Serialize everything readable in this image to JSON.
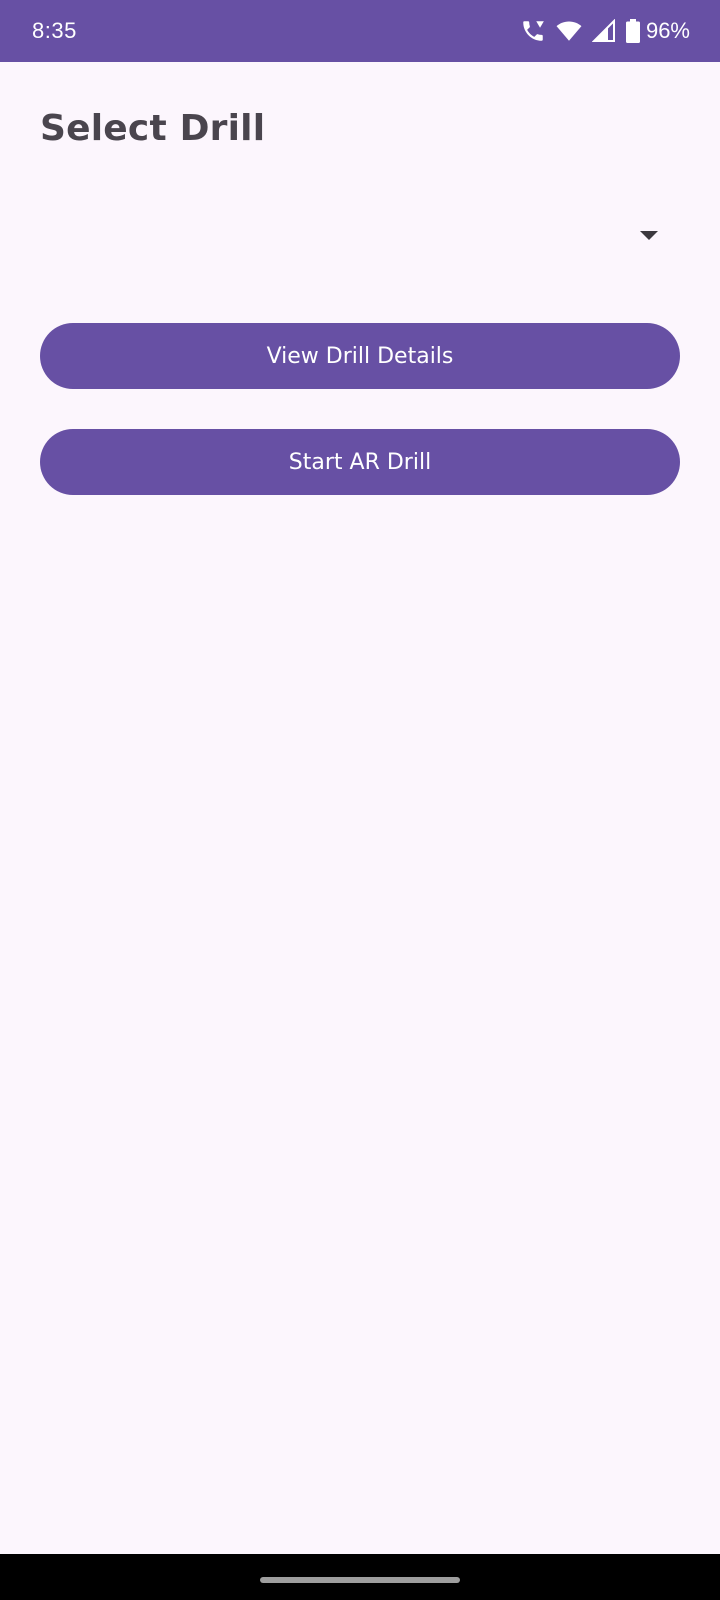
{
  "status_bar": {
    "time": "8:35",
    "battery_percent": "96%",
    "icons": [
      "wifi-calling-icon",
      "wifi-icon",
      "cell-signal-icon",
      "battery-icon"
    ],
    "background": "#6750A4"
  },
  "header": {
    "title": "Select Drill"
  },
  "drill_select": {
    "selected_value": ""
  },
  "buttons": {
    "view_details_label": "View Drill Details",
    "start_ar_label": "Start AR Drill"
  },
  "colors": {
    "primary": "#6750A4",
    "background": "#FCF6FD",
    "title_text": "#4A454E"
  }
}
